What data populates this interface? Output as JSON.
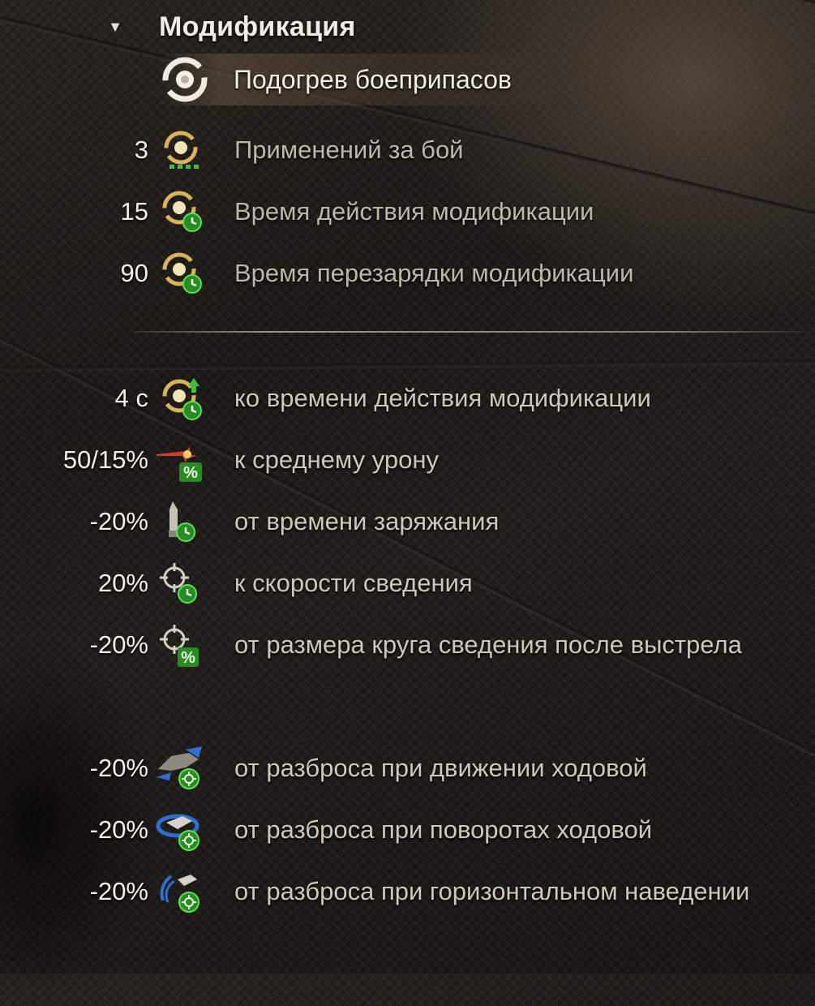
{
  "header": {
    "title": "Модификация",
    "icon": "chevron-down-icon"
  },
  "equipment": {
    "name": "Подогрев боеприпасов",
    "icon": "ammo-heating-icon"
  },
  "stats": [
    {
      "value": "3",
      "label": "Применений за бой",
      "icon": "uses-per-battle-icon"
    },
    {
      "value": "15",
      "label": "Время действия модификации",
      "icon": "duration-icon"
    },
    {
      "value": "90",
      "label": "Время перезарядки модификации",
      "icon": "cooldown-icon"
    }
  ],
  "effects": [
    {
      "value": "4 с",
      "label": "ко времени действия модификации",
      "icon": "duration-bonus-icon"
    },
    {
      "value": "50/15%",
      "label": "к среднему урону",
      "icon": "damage-percent-icon"
    },
    {
      "value": "-20%",
      "label": "от времени заряжания",
      "icon": "reload-time-icon"
    },
    {
      "value": "20%",
      "label": "к скорости сведения",
      "icon": "aiming-speed-icon"
    },
    {
      "value": "-20%",
      "label": "от размера круга сведения после выстрела",
      "icon": "dispersion-after-shot-icon"
    },
    {
      "value": "-20%",
      "label": "от разброса при движении ходовой",
      "icon": "dispersion-movement-icon"
    },
    {
      "value": "-20%",
      "label": "от разброса при поворотах ходовой",
      "icon": "dispersion-turning-icon"
    },
    {
      "value": "-20%",
      "label": "от разброса при горизонтальном наведении",
      "icon": "dispersion-traverse-icon"
    }
  ],
  "colors": {
    "accent_green": "#3fc23a",
    "gold": "#d9b25a",
    "text": "#cfc7ba",
    "value_text": "#f3eee6",
    "damage_red": "#e0442a"
  }
}
